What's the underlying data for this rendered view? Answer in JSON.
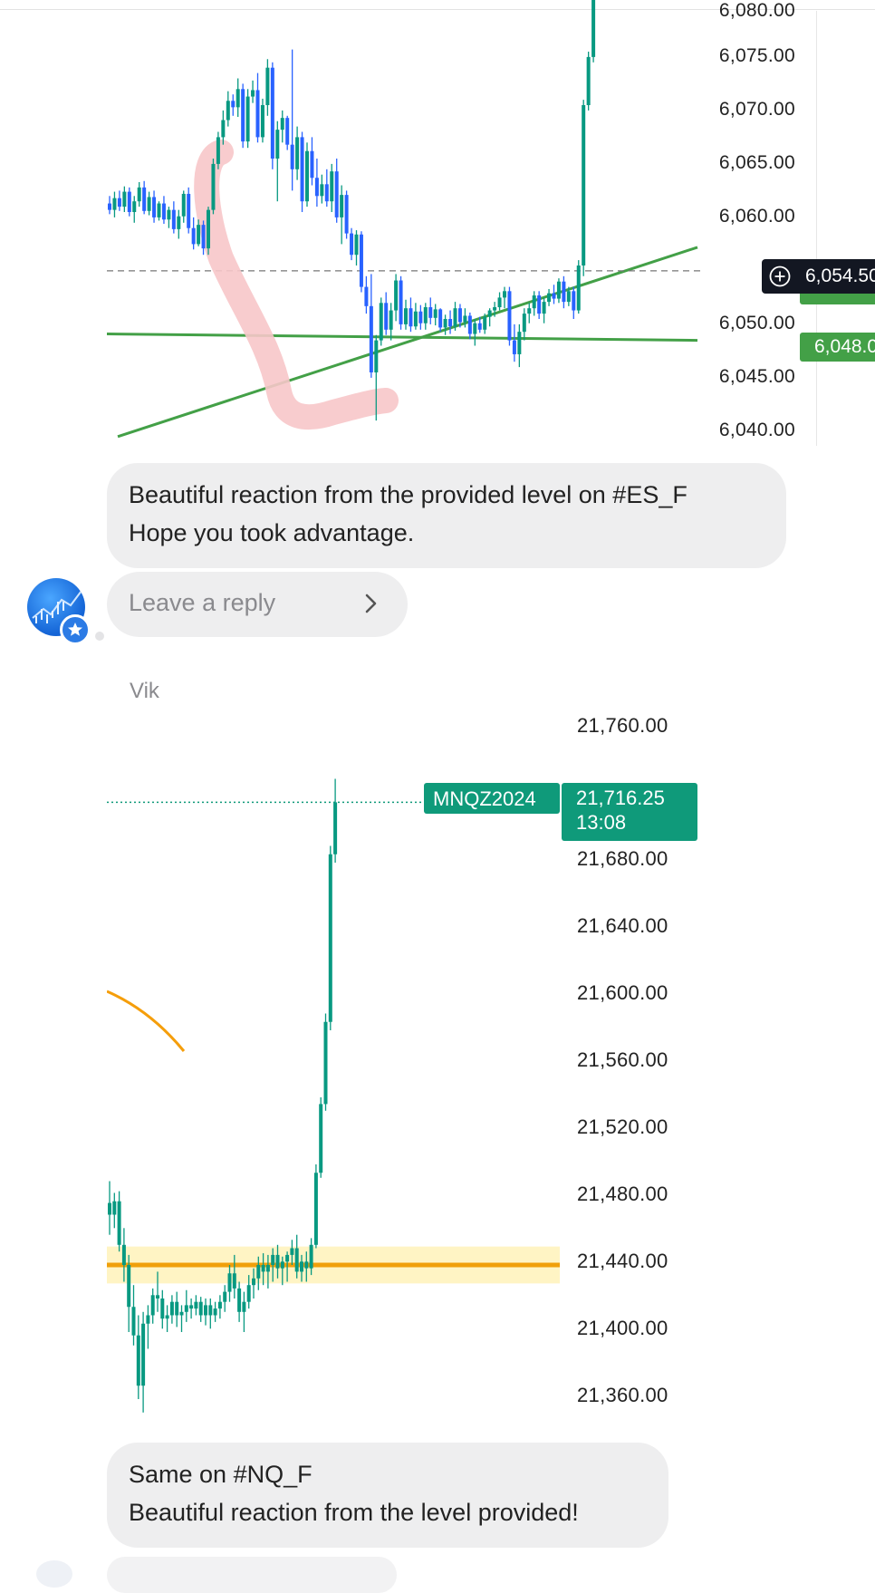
{
  "chart1": {
    "symbol": "#ES_F",
    "price_ticks": [
      "6,075.00",
      "6,070.00",
      "6,065.00",
      "6,060.00",
      "6,050.00",
      "6,045.00",
      "6,040.00"
    ],
    "current_price": "6,054.50",
    "level_price": "6,048.00",
    "colors": {
      "up": "#089981",
      "down": "#2962ff",
      "trendline": "#43a047",
      "annotation": "#f7c6c9"
    },
    "candles": [
      [
        6060.8,
        6061.5,
        6059.8,
        6060.2
      ],
      [
        6060.2,
        6061.9,
        6059.5,
        6061.3
      ],
      [
        6061.3,
        6062.0,
        6060.1,
        6060.5
      ],
      [
        6060.5,
        6062.4,
        6060.0,
        6061.9
      ],
      [
        6061.9,
        6062.3,
        6059.6,
        6060.0
      ],
      [
        6060.0,
        6061.5,
        6059.0,
        6061.0
      ],
      [
        6061.0,
        6062.8,
        6060.5,
        6062.3
      ],
      [
        6062.3,
        6062.9,
        6059.8,
        6060.1
      ],
      [
        6060.1,
        6061.9,
        6059.7,
        6061.4
      ],
      [
        6061.4,
        6062.0,
        6059.0,
        6059.5
      ],
      [
        6059.5,
        6061.0,
        6059.2,
        6060.8
      ],
      [
        6060.8,
        6061.5,
        6058.9,
        6059.3
      ],
      [
        6059.3,
        6060.5,
        6058.5,
        6060.2
      ],
      [
        6060.2,
        6061.0,
        6058.0,
        6058.4
      ],
      [
        6058.4,
        6060.2,
        6057.5,
        6059.6
      ],
      [
        6059.6,
        6062.0,
        6059.0,
        6061.7
      ],
      [
        6061.7,
        6062.3,
        6058.0,
        6058.5
      ],
      [
        6058.5,
        6059.5,
        6056.5,
        6057.0
      ],
      [
        6057.0,
        6059.3,
        6056.8,
        6058.8
      ],
      [
        6058.8,
        6059.2,
        6056.0,
        6056.6
      ],
      [
        6056.6,
        6060.5,
        6056.0,
        6060.2
      ],
      [
        6060.2,
        6065.0,
        6059.8,
        6064.5
      ],
      [
        6064.5,
        6067.5,
        6064.0,
        6067.0
      ],
      [
        6067.0,
        6069.5,
        6066.3,
        6068.6
      ],
      [
        6068.6,
        6071.3,
        6068.0,
        6070.4
      ],
      [
        6070.4,
        6071.0,
        6069.0,
        6069.8
      ],
      [
        6069.8,
        6072.5,
        6068.9,
        6071.5
      ],
      [
        6071.5,
        6072.0,
        6066.0,
        6066.6
      ],
      [
        6066.6,
        6071.5,
        6066.0,
        6070.8
      ],
      [
        6070.8,
        6072.3,
        6070.2,
        6071.4
      ],
      [
        6071.4,
        6073.0,
        6066.5,
        6067.0
      ],
      [
        6067.0,
        6070.6,
        6066.5,
        6070.0
      ],
      [
        6070.0,
        6074.3,
        6069.0,
        6073.5
      ],
      [
        6073.5,
        6074.0,
        6064.0,
        6065.0
      ],
      [
        6065.0,
        6068.5,
        6061.0,
        6067.7
      ],
      [
        6067.7,
        6069.5,
        6066.5,
        6068.8
      ],
      [
        6068.8,
        6069.0,
        6065.8,
        6066.3
      ],
      [
        6066.3,
        6075.2,
        6062.0,
        6064.0
      ],
      [
        6064.0,
        6068.0,
        6063.0,
        6067.0
      ],
      [
        6067.0,
        6067.5,
        6060.0,
        6061.0
      ],
      [
        6061.0,
        6066.5,
        6060.5,
        6065.7
      ],
      [
        6065.7,
        6067.0,
        6062.5,
        6063.2
      ],
      [
        6063.2,
        6065.0,
        6060.5,
        6061.5
      ],
      [
        6061.5,
        6063.5,
        6060.8,
        6062.6
      ],
      [
        6062.6,
        6064.0,
        6060.5,
        6061.0
      ],
      [
        6061.0,
        6064.5,
        6060.0,
        6063.8
      ],
      [
        6063.8,
        6065.0,
        6059.0,
        6059.5
      ],
      [
        6059.5,
        6062.5,
        6057.0,
        6061.6
      ],
      [
        6061.6,
        6062.0,
        6057.5,
        6058.0
      ],
      [
        6058.0,
        6058.5,
        6055.5,
        6056.0
      ],
      [
        6056.0,
        6058.3,
        6055.0,
        6057.9
      ],
      [
        6057.9,
        6058.2,
        6052.5,
        6053.0
      ],
      [
        6053.0,
        6054.0,
        6050.5,
        6051.2
      ],
      [
        6051.2,
        6054.2,
        6044.5,
        6045.0
      ],
      [
        6045.0,
        6048.5,
        6040.5,
        6048.0
      ],
      [
        6048.0,
        6052.0,
        6047.5,
        6051.5
      ],
      [
        6051.5,
        6052.5,
        6048.5,
        6049.0
      ],
      [
        6049.0,
        6051.5,
        6048.0,
        6050.8
      ],
      [
        6050.8,
        6054.2,
        6049.8,
        6053.6
      ],
      [
        6053.6,
        6054.0,
        6049.0,
        6049.5
      ],
      [
        6049.5,
        6051.8,
        6049.0,
        6051.0
      ],
      [
        6051.0,
        6052.0,
        6048.8,
        6049.3
      ],
      [
        6049.3,
        6051.5,
        6049.0,
        6050.7
      ],
      [
        6050.7,
        6051.3,
        6049.0,
        6049.6
      ],
      [
        6049.6,
        6051.5,
        6049.0,
        6051.1
      ],
      [
        6051.1,
        6052.0,
        6049.5,
        6050.1
      ],
      [
        6050.1,
        6051.4,
        6049.4,
        6050.9
      ],
      [
        6050.9,
        6051.0,
        6048.8,
        6049.2
      ],
      [
        6049.2,
        6050.4,
        6048.5,
        6050.0
      ],
      [
        6050.0,
        6050.8,
        6048.6,
        6049.3
      ],
      [
        6049.3,
        6051.6,
        6048.9,
        6051.0
      ],
      [
        6051.0,
        6051.4,
        6049.2,
        6049.7
      ],
      [
        6049.7,
        6051.0,
        6049.2,
        6050.3
      ],
      [
        6050.3,
        6050.6,
        6048.1,
        6048.6
      ],
      [
        6048.6,
        6050.0,
        6047.5,
        6049.6
      ],
      [
        6049.6,
        6050.2,
        6048.7,
        6049.0
      ],
      [
        6049.0,
        6050.5,
        6048.6,
        6050.2
      ],
      [
        6050.2,
        6051.0,
        6049.3,
        6050.8
      ],
      [
        6050.8,
        6051.6,
        6050.2,
        6051.1
      ],
      [
        6051.1,
        6052.5,
        6050.8,
        6052.0
      ],
      [
        6052.0,
        6053.0,
        6051.0,
        6052.6
      ],
      [
        6052.6,
        6053.0,
        6047.5,
        6048.0
      ],
      [
        6048.0,
        6049.5,
        6046.0,
        6046.7
      ],
      [
        6046.7,
        6049.5,
        6045.5,
        6048.8
      ],
      [
        6048.8,
        6051.0,
        6048.0,
        6050.5
      ],
      [
        6050.5,
        6051.5,
        6049.6,
        6051.0
      ],
      [
        6051.0,
        6052.6,
        6050.3,
        6052.2
      ],
      [
        6052.2,
        6052.6,
        6050.0,
        6050.5
      ],
      [
        6050.5,
        6052.0,
        6049.6,
        6051.6
      ],
      [
        6051.6,
        6052.8,
        6051.2,
        6052.4
      ],
      [
        6052.4,
        6053.2,
        6051.4,
        6051.9
      ],
      [
        6051.9,
        6053.8,
        6051.5,
        6053.5
      ],
      [
        6053.5,
        6054.0,
        6051.0,
        6051.6
      ],
      [
        6051.6,
        6053.0,
        6051.2,
        6052.6
      ],
      [
        6052.6,
        6053.0,
        6050.0,
        6050.8
      ],
      [
        6050.8,
        6055.5,
        6050.5,
        6055.0
      ],
      [
        6055.0,
        6070.5,
        6054.0,
        6070.0
      ],
      [
        6070.0,
        6075.0,
        6069.5,
        6074.5
      ],
      [
        6074.5,
        6082.0,
        6074.0,
        6081.5
      ]
    ]
  },
  "message1": {
    "line1": "Beautiful reaction from the provided level on #ES_F",
    "line2": "Hope you took advantage.",
    "reply_placeholder": "Leave a reply"
  },
  "sender": "Vik",
  "chart2": {
    "symbol": "MNQZ2024",
    "price_ticks": [
      "21,760.00",
      "21,680.00",
      "21,640.00",
      "21,600.00",
      "21,560.00",
      "21,520.00",
      "21,480.00",
      "21,440.00",
      "21,400.00",
      "21,360.00"
    ],
    "current_price": "21,716.25",
    "countdown": "13:08",
    "level": 21440,
    "colors": {
      "up": "#089981",
      "down": "#089981",
      "level": "#f0a00a",
      "zone": "#fff4c4",
      "arc": "#f59e0b"
    },
    "candles": [
      [
        21477,
        21490,
        21458,
        21470
      ],
      [
        21470,
        21483,
        21462,
        21478
      ],
      [
        21478,
        21484,
        21448,
        21452
      ],
      [
        21452,
        21462,
        21430,
        21440
      ],
      [
        21440,
        21446,
        21400,
        21415
      ],
      [
        21415,
        21428,
        21392,
        21398
      ],
      [
        21398,
        21410,
        21360,
        21368
      ],
      [
        21368,
        21412,
        21352,
        21405
      ],
      [
        21405,
        21416,
        21390,
        21410
      ],
      [
        21410,
        21426,
        21405,
        21422
      ],
      [
        21422,
        21436,
        21412,
        21420
      ],
      [
        21420,
        21425,
        21402,
        21408
      ],
      [
        21408,
        21416,
        21400,
        21410
      ],
      [
        21410,
        21422,
        21405,
        21418
      ],
      [
        21418,
        21424,
        21403,
        21410
      ],
      [
        21410,
        21416,
        21400,
        21412
      ],
      [
        21412,
        21425,
        21406,
        21416
      ],
      [
        21416,
        21420,
        21408,
        21414
      ],
      [
        21414,
        21422,
        21410,
        21418
      ],
      [
        21418,
        21421,
        21406,
        21410
      ],
      [
        21410,
        21420,
        21404,
        21416
      ],
      [
        21416,
        21420,
        21402,
        21410
      ],
      [
        21410,
        21418,
        21406,
        21414
      ],
      [
        21414,
        21422,
        21408,
        21418
      ],
      [
        21418,
        21428,
        21412,
        21424
      ],
      [
        21424,
        21440,
        21418,
        21435
      ],
      [
        21435,
        21446,
        21420,
        21426
      ],
      [
        21426,
        21430,
        21406,
        21412
      ],
      [
        21412,
        21424,
        21400,
        21418
      ],
      [
        21418,
        21434,
        21414,
        21428
      ],
      [
        21428,
        21438,
        21420,
        21432
      ],
      [
        21432,
        21445,
        21425,
        21440
      ],
      [
        21440,
        21447,
        21428,
        21436
      ],
      [
        21436,
        21446,
        21426,
        21440
      ],
      [
        21440,
        21450,
        21430,
        21446
      ],
      [
        21446,
        21452,
        21432,
        21438
      ],
      [
        21438,
        21445,
        21428,
        21442
      ],
      [
        21442,
        21448,
        21430,
        21446
      ],
      [
        21446,
        21455,
        21440,
        21450
      ],
      [
        21450,
        21458,
        21432,
        21436
      ],
      [
        21436,
        21446,
        21430,
        21442
      ],
      [
        21442,
        21448,
        21430,
        21438
      ],
      [
        21438,
        21456,
        21434,
        21452
      ],
      [
        21452,
        21500,
        21450,
        21495
      ],
      [
        21495,
        21540,
        21492,
        21536
      ],
      [
        21536,
        21590,
        21532,
        21585
      ],
      [
        21585,
        21690,
        21580,
        21685
      ],
      [
        21685,
        21730,
        21680,
        21716
      ]
    ]
  },
  "message2": {
    "line1": "Same on #NQ_F",
    "line2": "Beautiful reaction from the level provided!"
  }
}
